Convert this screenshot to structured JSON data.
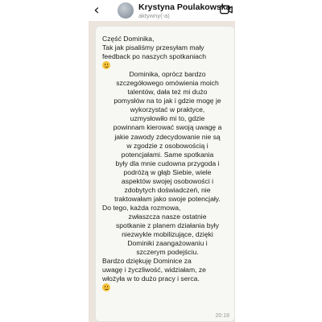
{
  "header": {
    "back_glyph": "‹",
    "contact_name": "Krystyna Poulakowska",
    "contact_status": "aktywny(-a)",
    "icons": {
      "back": "back-arrow-icon",
      "avatar": "avatar",
      "video": "video-camera-icon"
    }
  },
  "message": {
    "lines": [
      "Część Dominika,",
      "Tak jak pisaliśmy przesyłam mały",
      "feedback po naszych spotkaniach",
      "",
      "Dominika, oprócz bardzo",
      "szczegółowego  omówienia moich",
      "talentów, dała też mi dużo",
      "pomysłów na to jak i gdzie mogę je",
      "wykorzystać w praktyce,",
      "uzmysłowiło mi to, gdzie",
      "powinnam kierować swoją uwagę a",
      "jakie zawody zdecydowanie nie są",
      "w zgodzie z osobowością i",
      "potencjałami.  Same spotkania",
      "były dla mnie cudowna przygoda i",
      "podróżą w głąb Siebie, wiele",
      "aspektów swojej osobowości i",
      "zdobytych doświadczeń, nie",
      "traktowałam jako swoje potencjały.",
      "Do tego, każda rozmowa,",
      "zwłaszcza nasze ostatnie",
      "spotkanie z planem działania były",
      "niezwykle mobilizujące, dzięki",
      "Dominiki zaangażowaniu i",
      "szczerym podejściu.",
      "Bardzo dziękuję Dominice za",
      "uwagę  i życzliwość,  widziałam, ze",
      "włożyła w to  dużo pracy i serca.",
      ""
    ],
    "emoji_names": [
      "smiling-face-emoji",
      "smiling-face-emoji"
    ],
    "timestamp": "20:18"
  },
  "colors": {
    "chat_background": "#ece5dd",
    "bubble": "#f7f8f4",
    "text": "#1b1b1b"
  }
}
